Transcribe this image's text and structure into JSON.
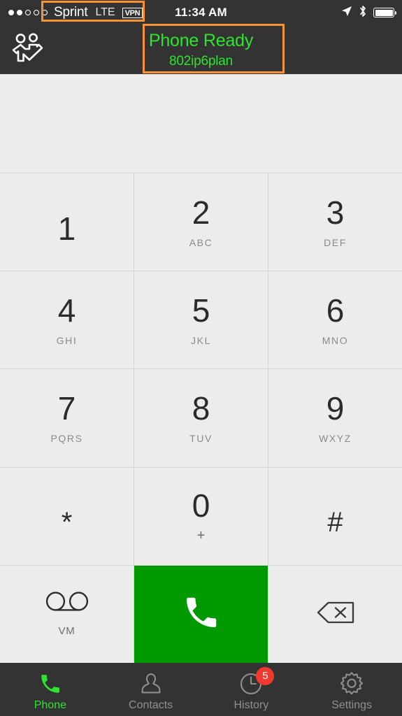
{
  "status_bar": {
    "signal_dots_total": 5,
    "signal_dots_filled": 2,
    "carrier": "Sprint",
    "network": "LTE",
    "vpn_label": "VPN",
    "time": "11:34 AM",
    "location_icon": "location-arrow-icon",
    "bluetooth_icon": "bluetooth-icon",
    "battery_icon": "battery-full-icon",
    "battery_level_percent": 100
  },
  "nav_bar": {
    "left_icon": "add-contacts-icon",
    "title": "Phone Ready",
    "subtitle": "802ip6plan",
    "title_color": "#2ee42e"
  },
  "display": {
    "entered_number": "",
    "placeholder": ""
  },
  "keypad": {
    "keys": [
      {
        "digit": "1",
        "letters": ""
      },
      {
        "digit": "2",
        "letters": "ABC"
      },
      {
        "digit": "3",
        "letters": "DEF"
      },
      {
        "digit": "4",
        "letters": "GHI"
      },
      {
        "digit": "5",
        "letters": "JKL"
      },
      {
        "digit": "6",
        "letters": "MNO"
      },
      {
        "digit": "7",
        "letters": "PQRS"
      },
      {
        "digit": "8",
        "letters": "TUV"
      },
      {
        "digit": "9",
        "letters": "WXYZ"
      },
      {
        "digit": "*",
        "letters": ""
      },
      {
        "digit": "0",
        "letters": "+"
      },
      {
        "digit": "#",
        "letters": ""
      }
    ],
    "voicemail": {
      "icon": "voicemail-icon",
      "label": "VM"
    },
    "call": {
      "icon": "phone-handset-icon",
      "color": "#009900",
      "label": ""
    },
    "delete": {
      "icon": "backspace-delete-icon",
      "label": ""
    }
  },
  "tab_bar": {
    "tabs": [
      {
        "label": "Phone",
        "icon": "phone-handset-icon",
        "active": true,
        "badge": ""
      },
      {
        "label": "Contacts",
        "icon": "person-icon",
        "active": false,
        "badge": ""
      },
      {
        "label": "History",
        "icon": "clock-icon",
        "active": false,
        "badge": "5"
      },
      {
        "label": "Settings",
        "icon": "gear-icon",
        "active": false,
        "badge": ""
      }
    ],
    "active_color": "#2ee42e",
    "inactive_color": "#8f8f8f",
    "badge_color": "#f03a2e"
  },
  "annotations": {
    "box_color": "#f79336",
    "boxes": [
      {
        "name": "carrier-highlight"
      },
      {
        "name": "phone-status-highlight"
      }
    ]
  }
}
